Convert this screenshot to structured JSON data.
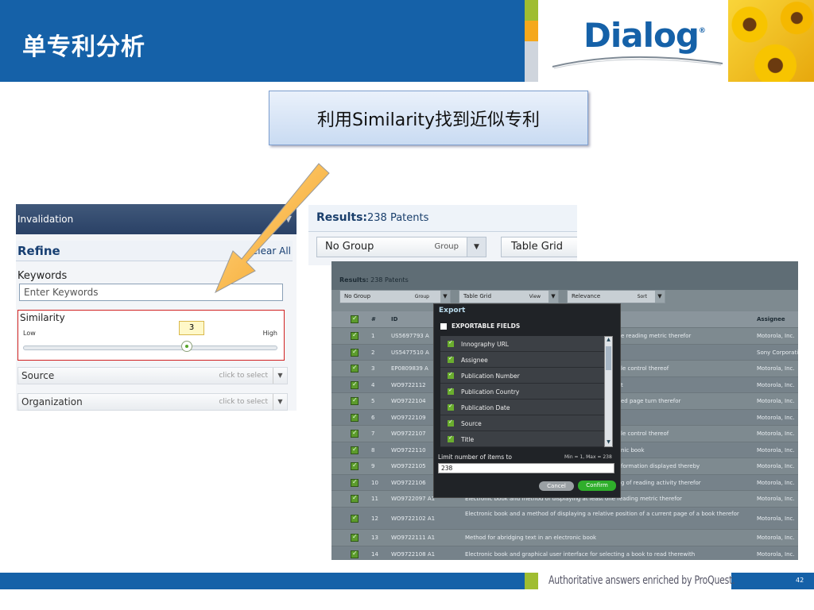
{
  "slide": {
    "title": "单专利分析",
    "callout": "利用Similarity找到近似专利",
    "logo": "Dialog",
    "logo_mark": "®",
    "footer_tagline": "Authoritative answers enriched by ProQuest.",
    "page_number": "42",
    "colors": {
      "brand_blue": "#1561a8",
      "accent_green": "#9fbd31",
      "accent_orange": "#f5a81c"
    }
  },
  "screenshot1": {
    "header": "Invalidation",
    "refine_title": "Refine",
    "clear_all": "Clear All",
    "keywords_label": "Keywords",
    "keywords_placeholder": "Enter Keywords",
    "similarity_label": "Similarity",
    "low": "Low",
    "high": "High",
    "slider_value": "3",
    "source_label": "Source",
    "organization_label": "Organization",
    "click_to_select": "click to select"
  },
  "screenshot2": {
    "results_label": "Results:",
    "results_count": "238 Patents",
    "group_value": "No Group",
    "group_label": "Group",
    "view_value": "Table Grid"
  },
  "screenshot3": {
    "results_label": "Results:",
    "results_count": "238 Patents",
    "group_value": "No Group",
    "group_label": "Group",
    "view_value": "Table Grid",
    "view_label": "View",
    "sort_value": "Relevance",
    "sort_label": "Sort",
    "columns": {
      "num": "#",
      "id": "ID",
      "assignee": "Assignee"
    },
    "rows": [
      {
        "n": "1",
        "id": "US5697793 A",
        "title": "e reading metric therefor",
        "assignee": "Motorola, Inc."
      },
      {
        "n": "2",
        "id": "US5477510 A",
        "title": "",
        "assignee": "Sony Corporation"
      },
      {
        "n": "3",
        "id": "EP0809839 A",
        "title": "le control thereof",
        "assignee": "Motorola, Inc."
      },
      {
        "n": "4",
        "id": "WO9722112",
        "title": "t",
        "assignee": "Motorola, Inc."
      },
      {
        "n": "5",
        "id": "WO9722104",
        "title": "ed page turn therefor",
        "assignee": "Motorola, Inc."
      },
      {
        "n": "6",
        "id": "WO9722109",
        "title": "",
        "assignee": "Motorola, Inc."
      },
      {
        "n": "7",
        "id": "WO9722107",
        "title": "le control thereof",
        "assignee": "Motorola, Inc."
      },
      {
        "n": "8",
        "id": "WO9722110",
        "title": "nic book",
        "assignee": "Motorola, Inc."
      },
      {
        "n": "9",
        "id": "WO9722105",
        "title": "formation displayed thereby",
        "assignee": "Motorola, Inc."
      },
      {
        "n": "10",
        "id": "WO9722106",
        "title": "g of reading activity therefor",
        "assignee": "Motorola, Inc."
      },
      {
        "n": "11",
        "id": "WO9722097 A1",
        "title": "Electronic book and method of displaying at least one reading metric therefor",
        "assignee": "Motorola, Inc."
      },
      {
        "n": "12",
        "id": "WO9722102 A1",
        "title": "Electronic book and a method of displaying a relative position of a current page of a book therefor",
        "assignee": "Motorola, Inc."
      },
      {
        "n": "13",
        "id": "WO9722111 A1",
        "title": "Method for abridging text in an electronic book",
        "assignee": "Motorola, Inc."
      },
      {
        "n": "14",
        "id": "WO9722108 A1",
        "title": "Electronic book and graphical user interface for selecting a book to read therewith",
        "assignee": "Motorola, Inc."
      }
    ],
    "export": {
      "title": "Export",
      "fields_header": "EXPORTABLE FIELDS",
      "fields": [
        "Innography URL",
        "Assignee",
        "Publication Number",
        "Publication Country",
        "Publication Date",
        "Source",
        "Title"
      ],
      "limit_label": "Limit number of items to",
      "min_max": "Min = 1, Max = 238",
      "limit_value": "238",
      "cancel": "Cancel",
      "confirm": "Confirm"
    }
  }
}
